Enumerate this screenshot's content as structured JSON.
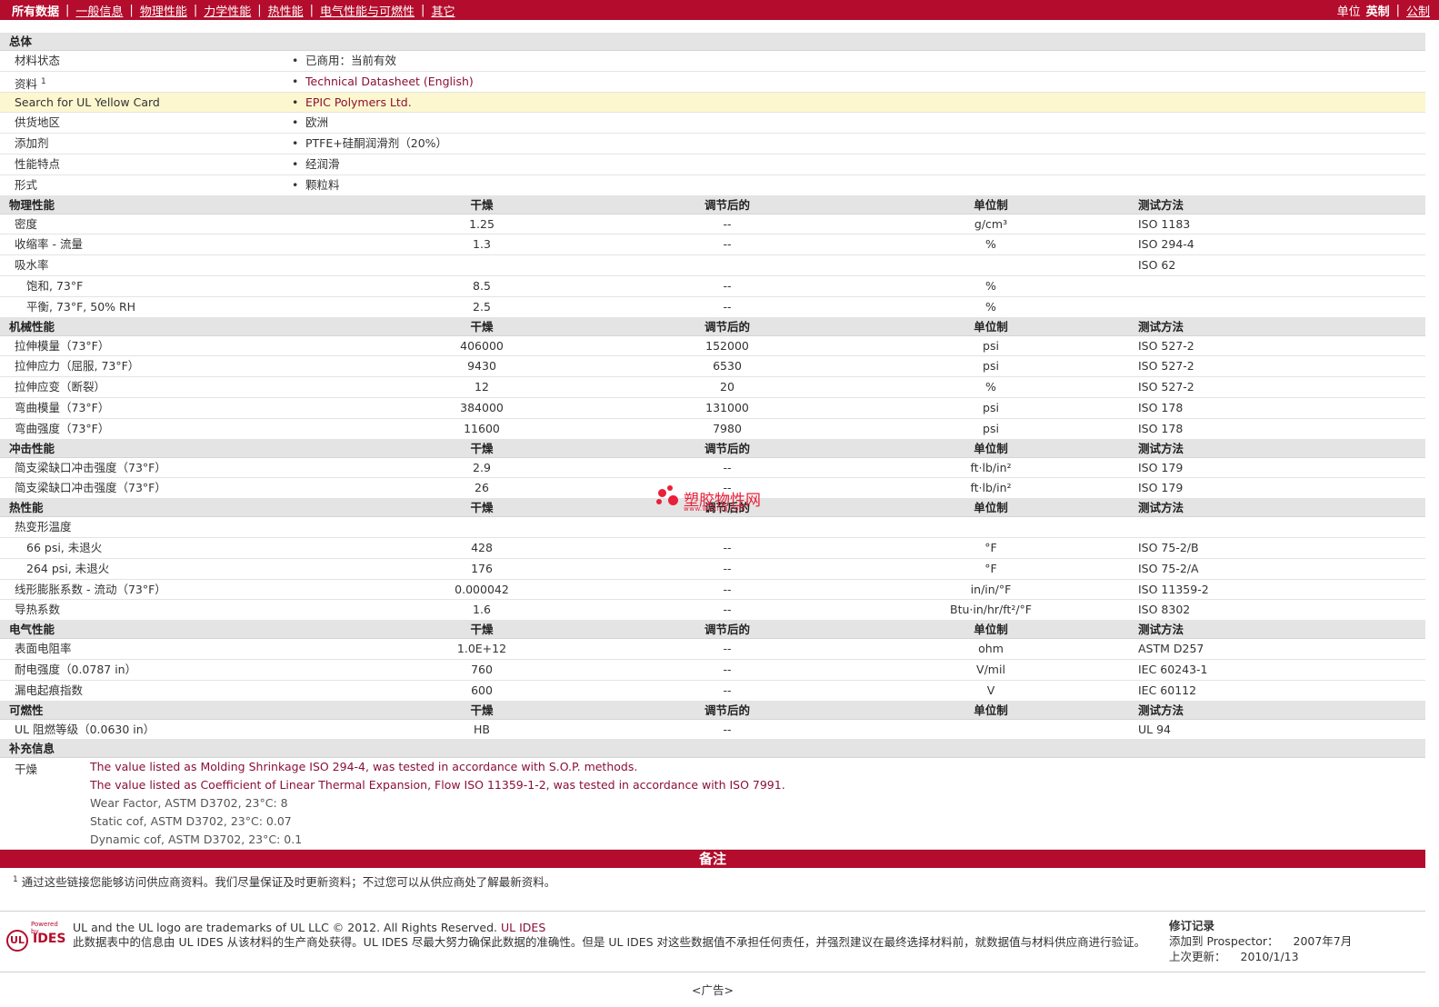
{
  "nav": {
    "tabs": [
      "所有数据",
      "一般信息",
      "物理性能",
      "力学性能",
      "热性能",
      "电气性能与可燃性",
      "其它"
    ],
    "units_label": "单位",
    "unit_active": "英制",
    "unit_other": "公制"
  },
  "general": {
    "title": "总体",
    "rows": [
      {
        "name": "材料状态",
        "value": "已商用：当前有效"
      },
      {
        "name": "资料",
        "sup": "1",
        "value": "Technical Datasheet (English)"
      },
      {
        "name": "Search for UL Yellow Card",
        "value": "EPIC Polymers Ltd."
      },
      {
        "name": "供货地区",
        "value": "欧洲"
      },
      {
        "name": "添加剂",
        "value": "PTFE+硅酮润滑剂（20%）"
      },
      {
        "name": "性能特点",
        "value": "经润滑"
      },
      {
        "name": "形式",
        "value": "颗粒料"
      }
    ]
  },
  "headers": {
    "dry": "干燥",
    "conditioned": "调节后的",
    "units": "单位制",
    "method": "测试方法"
  },
  "physical": {
    "title": "物理性能",
    "rows": [
      {
        "name": "密度",
        "dry": "1.25",
        "cond": "--",
        "unit": "g/cm³",
        "method": "ISO 1183"
      },
      {
        "name": "收缩率 - 流量",
        "dry": "1.3",
        "cond": "--",
        "unit": "%",
        "method": "ISO 294-4"
      },
      {
        "name": "吸水率",
        "dry": "",
        "cond": "",
        "unit": "",
        "method": "ISO 62"
      },
      {
        "name": "饱和, 73°F",
        "dry": "8.5",
        "cond": "--",
        "unit": "%",
        "method": ""
      },
      {
        "name": "平衡, 73°F, 50% RH",
        "dry": "2.5",
        "cond": "--",
        "unit": "%",
        "method": ""
      }
    ]
  },
  "mechanical": {
    "title": "机械性能",
    "rows": [
      {
        "name": "拉伸模量（73°F）",
        "dry": "406000",
        "cond": "152000",
        "unit": "psi",
        "method": "ISO 527-2"
      },
      {
        "name": "拉伸应力（屈服, 73°F）",
        "dry": "9430",
        "cond": "6530",
        "unit": "psi",
        "method": "ISO 527-2"
      },
      {
        "name": "拉伸应变（断裂）",
        "dry": "12",
        "cond": "20",
        "unit": "%",
        "method": "ISO 527-2"
      },
      {
        "name": "弯曲模量（73°F）",
        "dry": "384000",
        "cond": "131000",
        "unit": "psi",
        "method": "ISO 178"
      },
      {
        "name": "弯曲强度（73°F）",
        "dry": "11600",
        "cond": "7980",
        "unit": "psi",
        "method": "ISO 178"
      }
    ]
  },
  "impact": {
    "title": "冲击性能",
    "rows": [
      {
        "name": "简支梁缺口冲击强度（73°F）",
        "dry": "2.9",
        "cond": "--",
        "unit": "ft·lb/in²",
        "method": "ISO 179"
      },
      {
        "name": "简支梁缺口冲击强度（73°F）",
        "dry": "26",
        "cond": "--",
        "unit": "ft·lb/in²",
        "method": "ISO 179"
      }
    ]
  },
  "thermal": {
    "title": "热性能",
    "rows": [
      {
        "name": "热变形温度",
        "dry": "",
        "cond": "",
        "unit": "",
        "method": ""
      },
      {
        "name": "66 psi, 未退火",
        "dry": "428",
        "cond": "--",
        "unit": "°F",
        "method": "ISO 75-2/B"
      },
      {
        "name": "264 psi, 未退火",
        "dry": "176",
        "cond": "--",
        "unit": "°F",
        "method": "ISO 75-2/A"
      },
      {
        "name": "线形膨胀系数 - 流动（73°F）",
        "dry": "0.000042",
        "cond": "--",
        "unit": "in/in/°F",
        "method": "ISO 11359-2"
      },
      {
        "name": "导热系数",
        "dry": "1.6",
        "cond": "--",
        "unit": "Btu·in/hr/ft²/°F",
        "method": "ISO 8302"
      }
    ]
  },
  "electrical": {
    "title": "电气性能",
    "rows": [
      {
        "name": "表面电阻率",
        "dry": "1.0E+12",
        "cond": "--",
        "unit": "ohm",
        "method": "ASTM D257"
      },
      {
        "name": "耐电强度（0.0787 in）",
        "dry": "760",
        "cond": "--",
        "unit": "V/mil",
        "method": "IEC 60243-1"
      },
      {
        "name": "漏电起痕指数",
        "dry": "600",
        "cond": "--",
        "unit": "V",
        "method": "IEC 60112"
      }
    ]
  },
  "flammability": {
    "title": "可燃性",
    "rows": [
      {
        "name": "UL 阻燃等级（0.0630 in）",
        "dry": "HB",
        "cond": "--",
        "unit": "",
        "method": "UL 94"
      }
    ]
  },
  "supplemental": {
    "title": "补充信息",
    "label": "干燥",
    "lines": [
      "The value listed as Molding Shrinkage ISO 294-4, was tested in accordance with S.O.P. methods.",
      "The value listed as Coefficient of Linear Thermal Expansion, Flow ISO 11359-1-2, was tested in accordance with ISO 7991.",
      "Wear Factor, ASTM D3702, 23°C: 8",
      "Static cof, ASTM D3702, 23°C: 0.07",
      "Dynamic cof, ASTM D3702, 23°C: 0.1"
    ]
  },
  "notes": {
    "title": "备注",
    "footnote_sup": "1",
    "footnote": "通过这些链接您能够访问供应商资料。我们尽量保证及时更新资料；不过您可以从供应商处了解最新资料。"
  },
  "footer": {
    "logo_powered": "Powered by",
    "logo_ul": "UL",
    "logo_ides": "IDES",
    "trademark": "UL and the UL logo are trademarks of UL LLC © 2012. All Rights Reserved.",
    "trademark_link": "UL IDES",
    "disclaimer": "此数据表中的信息由 UL IDES 从该材料的生产商处获得。UL IDES 尽最大努力确保此数据的准确性。但是 UL IDES 对这些数据值不承担任何责任，并强烈建议在最终选择材料前，就数据值与材料供应商进行验证。",
    "revision_title": "修订记录",
    "added_label": "添加到 Prospector：",
    "added_value": "2007年7月",
    "updated_label": "上次更新：",
    "updated_value": "2010/1/13",
    "ad": "<广告>"
  },
  "watermark": {
    "text": "塑胶物性网",
    "url": "www.wuxing.com"
  },
  "colors": {
    "brand_red": "#b30c2c",
    "link": "#8b1035",
    "section_bg": "#e4e4e4",
    "highlight": "#fdf7cf"
  }
}
